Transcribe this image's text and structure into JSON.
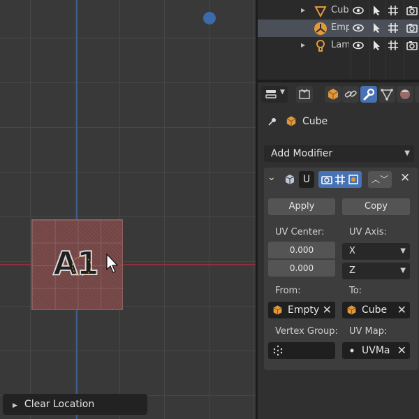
{
  "viewport": {
    "overlay_text": "A1",
    "last_operator": "Clear Location"
  },
  "outliner": {
    "rows": [
      {
        "name": "Cube",
        "icon": "triangle-mesh-icon",
        "selected": false
      },
      {
        "name": "Empty",
        "icon": "empty-axes-icon",
        "selected": true
      },
      {
        "name": "Lamp",
        "icon": "lamp-icon",
        "selected": false
      }
    ]
  },
  "properties": {
    "context_object": "Cube",
    "add_modifier": "Add Modifier",
    "modifier": {
      "name": "U",
      "apply_label": "Apply",
      "copy_label": "Copy",
      "uv_center_label": "UV Center:",
      "uv_center_x": "0.000",
      "uv_center_y": "0.000",
      "uv_axis_label": "UV Axis:",
      "uv_axis_1": "X",
      "uv_axis_2": "Z",
      "from_label": "From:",
      "from_value": "Empty",
      "to_label": "To:",
      "to_value": "Cube",
      "vertex_group_label": "Vertex Group:",
      "vertex_group_value": "",
      "uv_map_label": "UV Map:",
      "uv_map_value": "UVMa"
    }
  },
  "colors": {
    "accent": "#4772b3",
    "x_axis": "#8e2f3a",
    "y_axis": "#3f5c8a",
    "selection_orange": "#e9a23b"
  }
}
